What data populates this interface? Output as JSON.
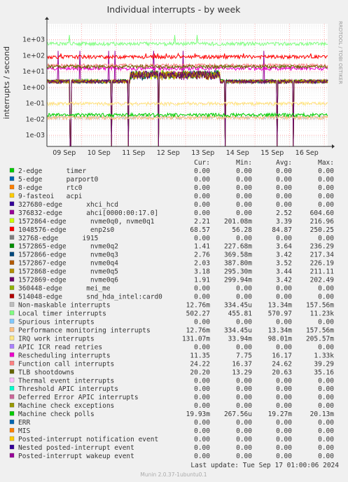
{
  "title": "Individual interrupts - by week",
  "ylabel": "interrupts / second",
  "side_label": "RRDTOOL / TOBI OETIKER",
  "footer": "Munin 2.0.37-1ubuntu0.1",
  "last_update": "Last update: Tue Sep 17 01:00:06 2024",
  "columns": {
    "cur": "Cur:",
    "min": "Min:",
    "avg": "Avg:",
    "max": "Max:"
  },
  "colors": {
    "background": "#f0f0f0",
    "plot_bg": "#ffffff",
    "grid_major": "#ff7f7f",
    "grid_minor": "#dddddd"
  },
  "chart_data": {
    "type": "line",
    "title": "Individual interrupts - by week",
    "ylabel": "interrupts / second",
    "yscale": "log",
    "ylim": [
      0.0002,
      10000
    ],
    "y_ticks": [
      "1e-03",
      "1e-02",
      "1e-01",
      "1e+00",
      "1e+01",
      "1e+02",
      "1e+03"
    ],
    "y_tick_values": [
      0.001,
      0.01,
      0.1,
      1,
      10,
      100,
      1000
    ],
    "xlim": [
      "Sep 9 (start)",
      "Sep 17 01:00"
    ],
    "x_range_days": [
      0,
      8.1
    ],
    "x_ticks": [
      "09 Sep",
      "10 Sep",
      "11 Sep",
      "12 Sep",
      "13 Sep",
      "14 Sep",
      "15 Sep",
      "16 Sep"
    ],
    "x_tick_positions_days": [
      0.5,
      1.5,
      2.5,
      3.5,
      4.5,
      5.5,
      6.5,
      7.5
    ],
    "grid": true,
    "series": [
      {
        "name": "2-edge      timer",
        "color": "#00cc00",
        "cur": "0.00",
        "min": "0.00",
        "avg": "0.00",
        "max": "0.00",
        "level": 0
      },
      {
        "name": "5-edge      parport0",
        "color": "#0066b3",
        "cur": "0.00",
        "min": "0.00",
        "avg": "0.00",
        "max": "0.00",
        "level": 0
      },
      {
        "name": "8-edge      rtc0",
        "color": "#ff8000",
        "cur": "0.00",
        "min": "0.00",
        "avg": "0.00",
        "max": "0.00",
        "level": 0
      },
      {
        "name": "9-fasteoi   acpi",
        "color": "#ffcc00",
        "cur": "0.00",
        "min": "0.00",
        "avg": "0.00",
        "max": "0.00",
        "level": 0
      },
      {
        "name": "327680-edge      xhci_hcd",
        "color": "#330099",
        "cur": "0.00",
        "min": "0.00",
        "avg": "0.00",
        "max": "0.00",
        "level": 0
      },
      {
        "name": "376832-edge      ahci[0000:00:17.0]",
        "color": "#990099",
        "cur": "0.00",
        "min": "0.00",
        "avg": "2.52",
        "max": "604.60",
        "level": 2.52,
        "spiky": true
      },
      {
        "name": "1572864-edge      nvme0q0, nvme0q1",
        "color": "#ccff00",
        "cur": "2.21",
        "min": "201.08m",
        "avg": "3.39",
        "max": "216.96",
        "level": 2.5
      },
      {
        "name": "1048576-edge      enp2s0",
        "color": "#ff0000",
        "cur": "68.57",
        "min": "56.28",
        "avg": "84.87",
        "max": "250.25",
        "level": 85
      },
      {
        "name": "32768-edge      i915",
        "color": "#808080",
        "cur": "0.00",
        "min": "0.00",
        "avg": "0.00",
        "max": "0.00",
        "level": 0
      },
      {
        "name": "1572865-edge      nvme0q2",
        "color": "#008f00",
        "cur": "1.41",
        "min": "227.68m",
        "avg": "3.64",
        "max": "236.29",
        "level": 2.6
      },
      {
        "name": "1572866-edge      nvme0q3",
        "color": "#00487d",
        "cur": "2.76",
        "min": "369.58m",
        "avg": "3.42",
        "max": "217.34",
        "level": 2.4
      },
      {
        "name": "1572867-edge      nvme0q4",
        "color": "#b35a00",
        "cur": "2.03",
        "min": "387.80m",
        "avg": "3.52",
        "max": "226.19",
        "level": 2.5
      },
      {
        "name": "1572868-edge      nvme0q5",
        "color": "#b38f00",
        "cur": "3.18",
        "min": "295.30m",
        "avg": "3.44",
        "max": "211.11",
        "level": 2.4
      },
      {
        "name": "1572869-edge      nvme0q6",
        "color": "#6b006b",
        "cur": "1.91",
        "min": "299.94m",
        "avg": "3.42",
        "max": "202.49",
        "level": 2.4
      },
      {
        "name": "360448-edge      mei_me",
        "color": "#8fb300",
        "cur": "0.00",
        "min": "0.00",
        "avg": "0.00",
        "max": "0.00",
        "level": 0
      },
      {
        "name": "514048-edge      snd_hda_intel:card0",
        "color": "#b30000",
        "cur": "0.00",
        "min": "0.00",
        "avg": "0.00",
        "max": "0.00",
        "level": 0
      },
      {
        "name": "Non-maskable interrupts",
        "color": "#bebebe",
        "cur": "12.76m",
        "min": "334.45u",
        "avg": "13.34m",
        "max": "157.56m",
        "level": 0.0133
      },
      {
        "name": "Local timer interrupts",
        "color": "#80ff80",
        "cur": "502.27",
        "min": "455.81",
        "avg": "570.97",
        "max": "11.23k",
        "level": 571
      },
      {
        "name": "Spurious interrupts",
        "color": "#80c9ff",
        "cur": "0.00",
        "min": "0.00",
        "avg": "0.00",
        "max": "0.00",
        "level": 0
      },
      {
        "name": "Performance monitoring interrupts",
        "color": "#ffc080",
        "cur": "12.76m",
        "min": "334.45u",
        "avg": "13.34m",
        "max": "157.56m",
        "level": 0.0133
      },
      {
        "name": "IRQ work interrupts",
        "color": "#ffe680",
        "cur": "131.07m",
        "min": "33.94m",
        "avg": "98.01m",
        "max": "205.57m",
        "level": 0.098
      },
      {
        "name": "APIC ICR read retries",
        "color": "#aa80ff",
        "cur": "0.00",
        "min": "0.00",
        "avg": "0.00",
        "max": "0.00",
        "level": 0
      },
      {
        "name": "Rescheduling interrupts",
        "color": "#ee00cc",
        "cur": "11.35",
        "min": "7.75",
        "avg": "16.17",
        "max": "1.33k",
        "level": 16
      },
      {
        "name": "Function call interrupts",
        "color": "#ff8080",
        "cur": "24.22",
        "min": "16.37",
        "avg": "24.62",
        "max": "39.29",
        "level": 24.6
      },
      {
        "name": "TLB shootdowns",
        "color": "#666600",
        "cur": "20.20",
        "min": "13.29",
        "avg": "20.63",
        "max": "35.16",
        "level": 20.6
      },
      {
        "name": "Thermal event interrupts",
        "color": "#ffbfff",
        "cur": "0.00",
        "min": "0.00",
        "avg": "0.00",
        "max": "0.00",
        "level": 0
      },
      {
        "name": "Threshold APIC interrupts",
        "color": "#00ffcc",
        "cur": "0.00",
        "min": "0.00",
        "avg": "0.00",
        "max": "0.00",
        "level": 0
      },
      {
        "name": "Deferred Error APIC interrupts",
        "color": "#cc6699",
        "cur": "0.00",
        "min": "0.00",
        "avg": "0.00",
        "max": "0.00",
        "level": 0
      },
      {
        "name": "Machine check exceptions",
        "color": "#999900",
        "cur": "0.00",
        "min": "0.00",
        "avg": "0.00",
        "max": "0.00",
        "level": 0
      },
      {
        "name": "Machine check polls",
        "color": "#00cc00",
        "cur": "19.93m",
        "min": "267.56u",
        "avg": "19.27m",
        "max": "20.13m",
        "level": 0.0193
      },
      {
        "name": "ERR",
        "color": "#0066b3",
        "cur": "0.00",
        "min": "0.00",
        "avg": "0.00",
        "max": "0.00",
        "level": 0
      },
      {
        "name": "MIS",
        "color": "#ff8000",
        "cur": "0.00",
        "min": "0.00",
        "avg": "0.00",
        "max": "0.00",
        "level": 0
      },
      {
        "name": "Posted-interrupt notification event",
        "color": "#ffcc00",
        "cur": "0.00",
        "min": "0.00",
        "avg": "0.00",
        "max": "0.00",
        "level": 0
      },
      {
        "name": "Nested posted-interrupt event",
        "color": "#330099",
        "cur": "0.00",
        "min": "0.00",
        "avg": "0.00",
        "max": "0.00",
        "level": 0
      },
      {
        "name": "Posted-interrupt wakeup event",
        "color": "#990099",
        "cur": "0.00",
        "min": "0.00",
        "avg": "0.00",
        "max": "0.00",
        "level": 0
      }
    ]
  }
}
